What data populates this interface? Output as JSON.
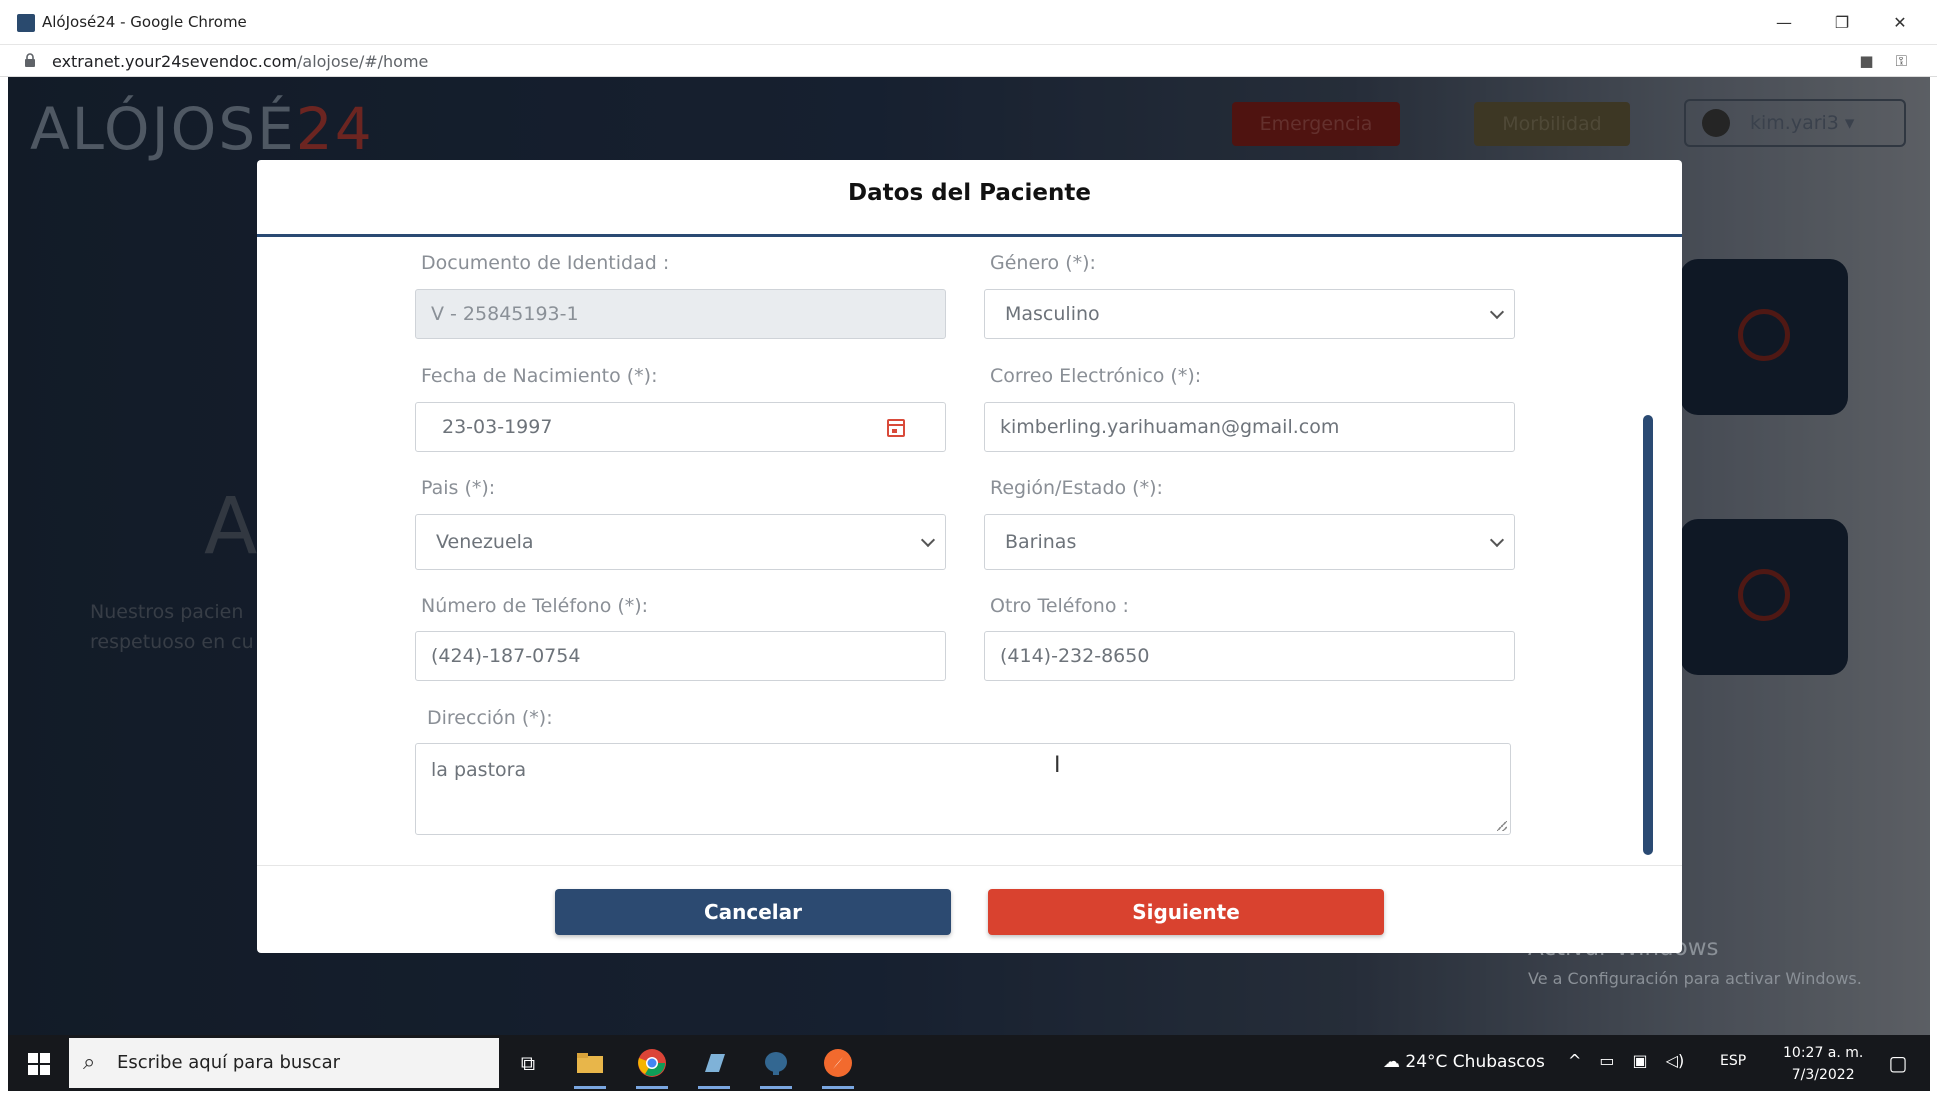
{
  "window": {
    "title": "AlóJosé24 - Google Chrome",
    "minimize": "—",
    "restore": "❐",
    "close": "✕"
  },
  "address": {
    "host": "extranet.your24sevendoc.com",
    "path": "/alojose/#/home"
  },
  "app": {
    "logo_main": "ALÓJOSÉ",
    "logo_accent": "24",
    "emergency_label": "Emergencia",
    "morbidity_label": "Morbilidad",
    "username": "kim.yari3 ▾",
    "bg_heading": "AL",
    "bg_paragraph": "Nuestros pacien respetuoso en cu"
  },
  "modal": {
    "title": "Datos del Paciente",
    "fields": {
      "documento_label": "Documento de Identidad :",
      "documento_value": "V - 25845193-1",
      "genero_label": "Género (*):",
      "genero_value": "Masculino",
      "fecha_label": "Fecha de Nacimiento (*):",
      "fecha_value": "23-03-1997",
      "correo_label": "Correo Electrónico (*):",
      "correo_value": "kimberling.yarihuaman@gmail.com",
      "pais_label": "Pais (*):",
      "pais_value": "Venezuela",
      "region_label": "Región/Estado (*):",
      "region_value": "Barinas",
      "telefono_label": "Número de Teléfono (*):",
      "telefono_value": "(424)-187-0754",
      "otro_tel_label": "Otro Teléfono :",
      "otro_tel_value": "(414)-232-8650",
      "direccion_label": "Dirección (*):",
      "direccion_value": "la pastora"
    },
    "cancel_label": "Cancelar",
    "next_label": "Siguiente"
  },
  "watermark": {
    "line1": "Activar Windows",
    "line2": "Ve a Configuración para activar Windows."
  },
  "taskbar": {
    "search_placeholder": "Escribe aquí para buscar",
    "weather": "24°C  Chubascos",
    "language": "ESP",
    "time": "10:27 a. m.",
    "date": "7/3/2022"
  },
  "colors": {
    "primary": "#2c4a71",
    "danger": "#d9422f",
    "modal_header_rule": "#2a4a73"
  }
}
